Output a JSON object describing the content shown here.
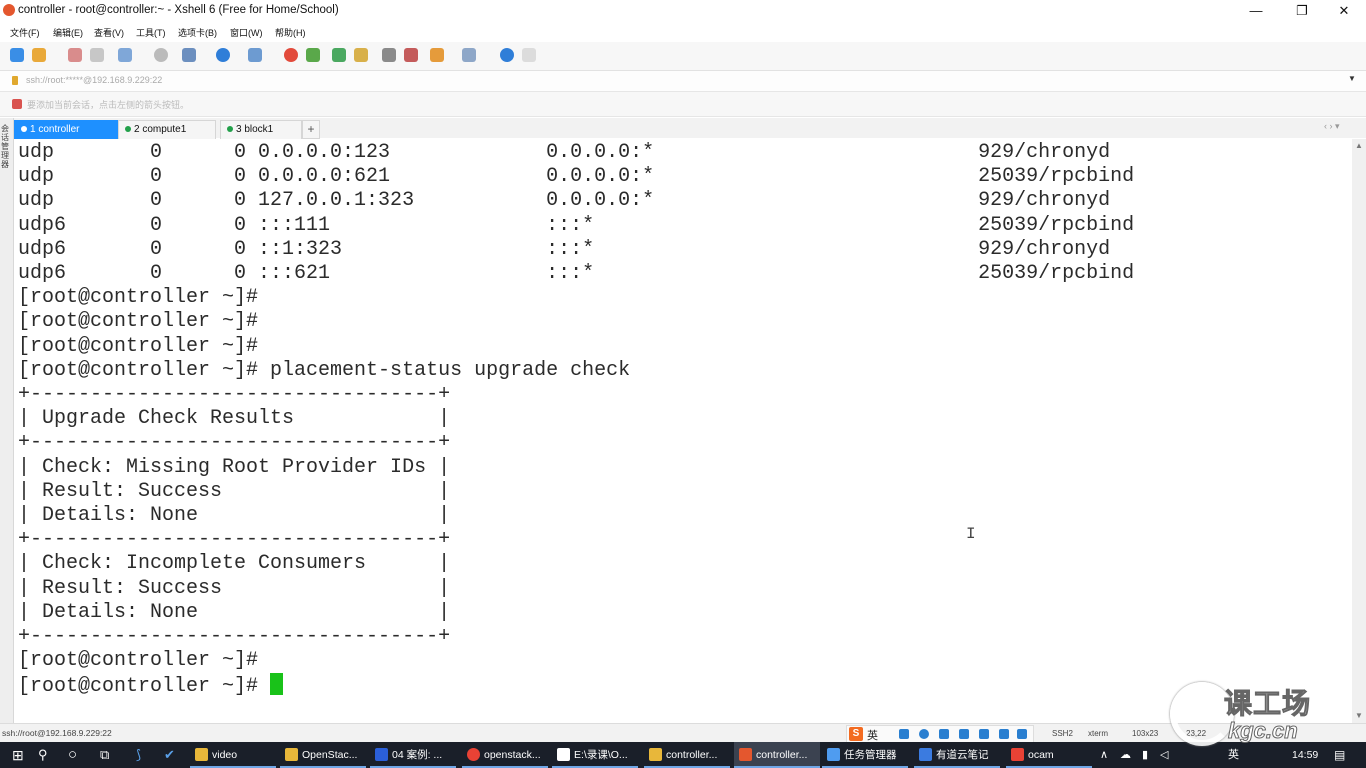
{
  "window": {
    "title": "controller - root@controller:~ - Xshell 6 (Free for Home/School)",
    "controls": {
      "minimize": "—",
      "maximize": "❐",
      "close": "✕"
    }
  },
  "menu": [
    "文件(F)",
    "编辑(E)",
    "查看(V)",
    "工具(T)",
    "选项卡(B)",
    "窗口(W)",
    "帮助(H)"
  ],
  "address": {
    "value": "ssh://root:*****@192.168.9.229:22",
    "dropdown": "▼"
  },
  "hint": {
    "text": "要添加当前会话，点击左侧的箭头按钮。"
  },
  "sidestrip": {
    "label": "会话管理器"
  },
  "tabs": [
    {
      "label": "1 controller",
      "active": true
    },
    {
      "label": "2 compute1",
      "active": false
    },
    {
      "label": "3 block1",
      "active": false
    }
  ],
  "tab_add": "+",
  "tab_nav": "‹ › ▾",
  "terminal": {
    "lines": [
      "udp        0      0 0.0.0.0:123             0.0.0.0:*                           929/chronyd",
      "udp        0      0 0.0.0.0:621             0.0.0.0:*                           25039/rpcbind",
      "udp        0      0 127.0.0.1:323           0.0.0.0:*                           929/chronyd",
      "udp6       0      0 :::111                  :::*                                25039/rpcbind",
      "udp6       0      0 ::1:323                 :::*                                929/chronyd",
      "udp6       0      0 :::621                  :::*                                25039/rpcbind",
      "[root@controller ~]#",
      "[root@controller ~]#",
      "[root@controller ~]#",
      "[root@controller ~]# placement-status upgrade check",
      "+----------------------------------+",
      "| Upgrade Check Results            |",
      "+----------------------------------+",
      "| Check: Missing Root Provider IDs |",
      "| Result: Success                  |",
      "| Details: None                    |",
      "+----------------------------------+",
      "| Check: Incomplete Consumers      |",
      "| Result: Success                  |",
      "| Details: None                    |",
      "+----------------------------------+",
      "[root@controller ~]#",
      "[root@controller ~]# "
    ],
    "ibeam": "I",
    "cursor_color": "#19c219"
  },
  "statusbar": {
    "left": "ssh://root@192.168.9.229:22",
    "ime_logo": "S",
    "ime_lang": "英",
    "protocol": "SSH2",
    "terminal_type": "xterm",
    "size": "103x23",
    "position": "23,22"
  },
  "taskbar": {
    "apps": [
      {
        "label": "video",
        "color": "#e8b73a"
      },
      {
        "label": "OpenStac...",
        "color": "#e8b73a"
      },
      {
        "label": "04 案例: ...",
        "color": "#2b5fd9"
      },
      {
        "label": "openstack...",
        "color": "#e94235"
      },
      {
        "label": "E:\\录课\\O...",
        "color": "#ffffff"
      },
      {
        "label": "controller...",
        "color": "#e8b73a"
      },
      {
        "label": "controller...",
        "color": "#e4572e"
      },
      {
        "label": "任务管理器",
        "color": "#4f9cf0"
      },
      {
        "label": "有道云笔记",
        "color": "#3b7be0"
      },
      {
        "label": "ocam",
        "color": "#e94235"
      }
    ],
    "time": "14:59",
    "lang": "英"
  },
  "watermark": {
    "top": "课工场",
    "bottom": "kgc.cn"
  },
  "colors": {
    "tab_active": "#1e90ff",
    "taskbar_bg": "#1a1f29",
    "terminal_fg": "#2b2b2b"
  }
}
